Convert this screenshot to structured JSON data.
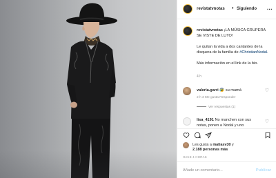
{
  "post": {
    "photo_label": "man in black hat and embroidered black suit",
    "colors": {
      "accent": "#0095f6",
      "link": "#00376b",
      "muted": "#8e8e8e",
      "border": "#efefef"
    }
  },
  "header": {
    "username": "revistatvnotas",
    "separator": "•",
    "follow_label": "Siguiendo",
    "more_label": "..."
  },
  "caption": {
    "username": "revistatvnotas",
    "headline": "¡LA MÚSICA GRUPERA SE VISTE DE LUTO!",
    "body": "Le quitan la vida a dos cantantes de la disquera de la familia de",
    "hashtag": "#ChristianNodal.",
    "more_info": "Más información en el link de la bio.",
    "age": "4 h"
  },
  "comments": [
    {
      "username": "valeria.garri",
      "text": "su mamá",
      "emoji": "😰",
      "meta": "2 h   3 Me gusta   Responder",
      "replies": "Ver respuestas (1)"
    },
    {
      "username": "lisa_4191",
      "text": "No manchen con sus notas, ponen a Nodal y uno"
    }
  ],
  "actions": {
    "like_icon": "heart-icon",
    "comment_icon": "comment-icon",
    "share_icon": "share-icon",
    "save_icon": "bookmark-icon"
  },
  "likes": {
    "line1_prefix": "Les gusta a",
    "line1_user": "matiasv30",
    "line1_suffix": "y",
    "line2": "2.188 personas más"
  },
  "timestamp": "HACE 4 HORAS",
  "composer": {
    "placeholder": "Añade un comentario...",
    "publish_label": "Publicar"
  }
}
